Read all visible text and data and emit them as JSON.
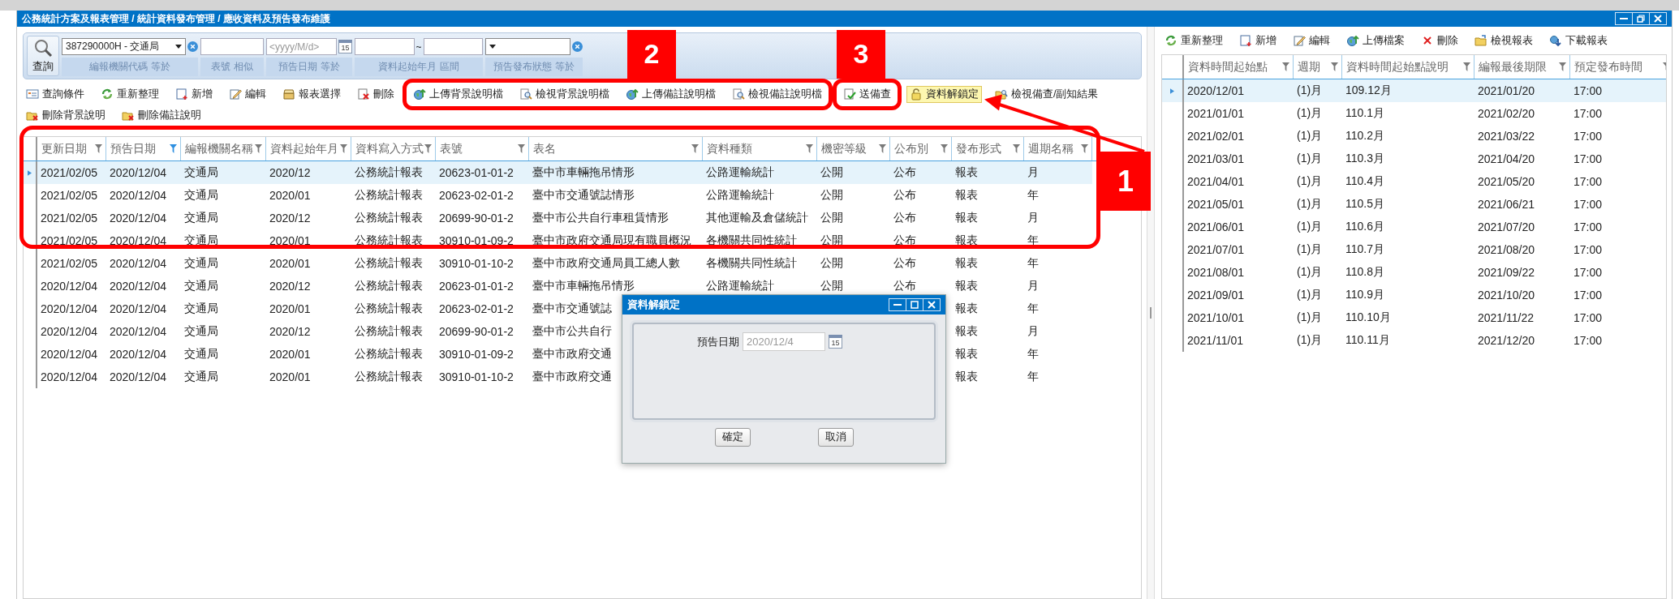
{
  "window": {
    "title": "公務統計方案及報表管理 / 統計資料發布管理 / 應收資料及預告發布維護"
  },
  "filter_bar": {
    "search_button": "查詢",
    "filters": [
      {
        "kind": "select",
        "value": "387290000H - 交通局",
        "label": "編報機關代碼 等於"
      },
      {
        "kind": "text",
        "label": "表號 相似"
      },
      {
        "kind": "date",
        "placeholder": "<yyyy/M/d>",
        "calendar_icon_text": "15",
        "label": "預告日期 等於"
      },
      {
        "kind": "range",
        "separator": "~",
        "label": "資料起始年月 區間"
      },
      {
        "kind": "select",
        "label": "預告發布狀態 等於"
      }
    ]
  },
  "toolbar_rows": [
    [
      {
        "label": "查詢條件",
        "highlighted": false
      },
      {
        "label": "重新整理",
        "highlighted": false
      },
      {
        "label": "新增",
        "highlighted": false
      },
      {
        "label": "編輯",
        "highlighted": false
      },
      {
        "label": "報表選擇",
        "highlighted": false
      },
      {
        "label": "刪除",
        "highlighted": false
      },
      {
        "label": "上傳背景說明檔",
        "highlighted": false
      },
      {
        "label": "檢視背景說明檔",
        "highlighted": false
      },
      {
        "label": "上傳備註說明檔",
        "highlighted": false
      },
      {
        "label": "檢視備註說明檔",
        "highlighted": false
      },
      {
        "label": "送備查",
        "highlighted": false
      },
      {
        "label": "資料解鎖定",
        "highlighted": true
      },
      {
        "label": "檢視備查/副知結果",
        "highlighted": false
      }
    ],
    [
      {
        "label": "刪除背景說明",
        "highlighted": false
      },
      {
        "label": "刪除備註說明",
        "highlighted": false
      }
    ]
  ],
  "main_table": {
    "columns": [
      {
        "label": "更新日期",
        "filtered": false
      },
      {
        "label": "預告日期",
        "filtered": true
      },
      {
        "label": "編報機關名稱",
        "filtered": false
      },
      {
        "label": "資料起始年月",
        "filtered": false
      },
      {
        "label": "資料寫入方式",
        "filtered": false
      },
      {
        "label": "表號",
        "filtered": false
      },
      {
        "label": "表名",
        "filtered": false
      },
      {
        "label": "資料種類",
        "filtered": false
      },
      {
        "label": "機密等級",
        "filtered": false
      },
      {
        "label": "公布別",
        "filtered": false
      },
      {
        "label": "發布形式",
        "filtered": false
      },
      {
        "label": "週期名稱",
        "filtered": false
      }
    ],
    "rows": [
      {
        "selected": true,
        "cells": [
          "2021/02/05",
          "2020/12/04",
          "交通局",
          "2020/12",
          "公務統計報表",
          "20623-01-01-2",
          "臺中市車輛拖吊情形",
          "公路運輸統計",
          "公開",
          "公布",
          "報表",
          "月"
        ]
      },
      {
        "selected": false,
        "cells": [
          "2021/02/05",
          "2020/12/04",
          "交通局",
          "2020/01",
          "公務統計報表",
          "20623-02-01-2",
          "臺中市交通號誌情形",
          "公路運輸統計",
          "公開",
          "公布",
          "報表",
          "年"
        ]
      },
      {
        "selected": false,
        "cells": [
          "2021/02/05",
          "2020/12/04",
          "交通局",
          "2020/12",
          "公務統計報表",
          "20699-90-01-2",
          "臺中市公共自行車租賃情形",
          "其他運輸及倉儲統計",
          "公開",
          "公布",
          "報表",
          "月"
        ]
      },
      {
        "selected": false,
        "cells": [
          "2021/02/05",
          "2020/12/04",
          "交通局",
          "2020/01",
          "公務統計報表",
          "30910-01-09-2",
          "臺中市政府交通局現有職員概況",
          "各機關共同性統計",
          "公開",
          "公布",
          "報表",
          "年"
        ]
      },
      {
        "selected": false,
        "cells": [
          "2021/02/05",
          "2020/12/04",
          "交通局",
          "2020/01",
          "公務統計報表",
          "30910-01-10-2",
          "臺中市政府交通局員工總人數",
          "各機關共同性統計",
          "公開",
          "公布",
          "報表",
          "年"
        ]
      },
      {
        "selected": false,
        "cells": [
          "2020/12/04",
          "2020/12/04",
          "交通局",
          "2020/12",
          "公務統計報表",
          "20623-01-01-2",
          "臺中市車輛拖吊情形",
          "公路運輸統計",
          "公開",
          "公布",
          "報表",
          "月"
        ]
      },
      {
        "selected": false,
        "cells": [
          "2020/12/04",
          "2020/12/04",
          "交通局",
          "2020/01",
          "公務統計報表",
          "20623-02-01-2",
          "臺中市交通號誌",
          null,
          null,
          null,
          "報表",
          "年"
        ]
      },
      {
        "selected": false,
        "cells": [
          "2020/12/04",
          "2020/12/04",
          "交通局",
          "2020/12",
          "公務統計報表",
          "20699-90-01-2",
          "臺中市公共自行",
          null,
          null,
          null,
          "報表",
          "月"
        ]
      },
      {
        "selected": false,
        "cells": [
          "2020/12/04",
          "2020/12/04",
          "交通局",
          "2020/01",
          "公務統計報表",
          "30910-01-09-2",
          "臺中市政府交通",
          null,
          null,
          null,
          "報表",
          "年"
        ]
      },
      {
        "selected": false,
        "cells": [
          "2020/12/04",
          "2020/12/04",
          "交通局",
          "2020/01",
          "公務統計報表",
          "30910-01-10-2",
          "臺中市政府交通",
          null,
          null,
          null,
          "報表",
          "年"
        ]
      }
    ]
  },
  "side_toolbar": [
    {
      "label": "重新整理"
    },
    {
      "label": "新增"
    },
    {
      "label": "編輯"
    },
    {
      "label": "上傳檔案"
    },
    {
      "label": "刪除"
    },
    {
      "label": "檢視報表"
    },
    {
      "label": "下載報表"
    }
  ],
  "schedule_table": {
    "columns": [
      {
        "label": "資料時間起始點",
        "filtered": false
      },
      {
        "label": "週期",
        "filtered": false
      },
      {
        "label": "資料時間起始點說明",
        "filtered": false
      },
      {
        "label": "編報最後期限",
        "filtered": false
      },
      {
        "label": "預定發布時間",
        "filtered": false
      }
    ],
    "rows": [
      {
        "selected": true,
        "cells": [
          "2020/12/01",
          "(1)月",
          "109.12月",
          "2021/01/20",
          "17:00"
        ]
      },
      {
        "selected": false,
        "cells": [
          "2021/01/01",
          "(1)月",
          "110.1月",
          "2021/02/20",
          "17:00"
        ]
      },
      {
        "selected": false,
        "cells": [
          "2021/02/01",
          "(1)月",
          "110.2月",
          "2021/03/22",
          "17:00"
        ]
      },
      {
        "selected": false,
        "cells": [
          "2021/03/01",
          "(1)月",
          "110.3月",
          "2021/04/20",
          "17:00"
        ]
      },
      {
        "selected": false,
        "cells": [
          "2021/04/01",
          "(1)月",
          "110.4月",
          "2021/05/20",
          "17:00"
        ]
      },
      {
        "selected": false,
        "cells": [
          "2021/05/01",
          "(1)月",
          "110.5月",
          "2021/06/21",
          "17:00"
        ]
      },
      {
        "selected": false,
        "cells": [
          "2021/06/01",
          "(1)月",
          "110.6月",
          "2021/07/20",
          "17:00"
        ]
      },
      {
        "selected": false,
        "cells": [
          "2021/07/01",
          "(1)月",
          "110.7月",
          "2021/08/20",
          "17:00"
        ]
      },
      {
        "selected": false,
        "cells": [
          "2021/08/01",
          "(1)月",
          "110.8月",
          "2021/09/22",
          "17:00"
        ]
      },
      {
        "selected": false,
        "cells": [
          "2021/09/01",
          "(1)月",
          "110.9月",
          "2021/10/20",
          "17:00"
        ]
      },
      {
        "selected": false,
        "cells": [
          "2021/10/01",
          "(1)月",
          "110.10月",
          "2021/11/22",
          "17:00"
        ]
      },
      {
        "selected": false,
        "cells": [
          "2021/11/01",
          "(1)月",
          "110.11月",
          "2021/12/20",
          "17:00"
        ]
      }
    ]
  },
  "dialog": {
    "title": "資料解鎖定",
    "field_label": "預告日期",
    "field_value": "2020/12/4",
    "field_disabled": true,
    "calendar_icon_text": "15",
    "buttons": [
      {
        "label": "確定"
      },
      {
        "label": "取消"
      }
    ]
  },
  "annotations": [
    {
      "label": "1"
    },
    {
      "label": "2"
    },
    {
      "label": "3"
    }
  ]
}
